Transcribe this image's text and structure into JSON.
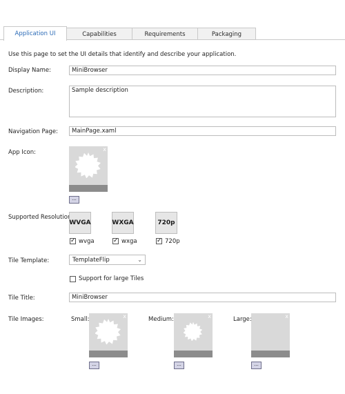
{
  "tabs": [
    {
      "label": "Application UI"
    },
    {
      "label": "Capabilities"
    },
    {
      "label": "Requirements"
    },
    {
      "label": "Packaging"
    }
  ],
  "intro": "Use this page to set the UI details that identify and describe your application.",
  "display_name": {
    "label": "Display Name:",
    "value": "MiniBrowser"
  },
  "description": {
    "label": "Description:",
    "value": "Sample description"
  },
  "navigation_page": {
    "label": "Navigation Page:",
    "value": "MainPage.xaml"
  },
  "app_icon": {
    "label": "App Icon:",
    "browse": "..."
  },
  "supported_resolutions": {
    "label": "Supported Resolutions:",
    "items": [
      {
        "badge": "WVGA",
        "label": "wvga",
        "checked": true
      },
      {
        "badge": "WXGA",
        "label": "wxga",
        "checked": true
      },
      {
        "badge": "720p",
        "label": "720p",
        "checked": true
      }
    ]
  },
  "tile_template": {
    "label": "Tile Template:",
    "value": "TemplateFlip"
  },
  "large_tiles": {
    "label": "Support for large Tiles",
    "checked": false
  },
  "tile_title": {
    "label": "Tile Title:",
    "value": "MiniBrowser"
  },
  "tile_images": {
    "label": "Tile Images:",
    "small": "Small:",
    "medium": "Medium:",
    "large": "Large:",
    "browse": "..."
  },
  "colors": {
    "active_tab_text": "#2a6ab6",
    "tile_bg": "#d9d9d9",
    "tile_bar": "#8c8c8c"
  },
  "icons": {
    "checkmark": "✓",
    "close": "x",
    "dropdown": "chevron-down"
  }
}
